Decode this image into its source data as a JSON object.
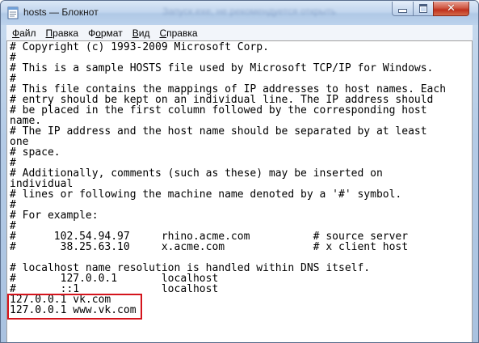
{
  "window": {
    "title": "hosts — Блокнот",
    "background_blur_text": "Запуск.exe, не рекомендуется открыть",
    "controls": {
      "minimize": "minimize",
      "maximize": "maximize",
      "close": "✕"
    }
  },
  "menu": [
    {
      "label": "Файл",
      "accel": "Ф",
      "rest": "айл"
    },
    {
      "label": "Правка",
      "accel": "П",
      "rest": "равка"
    },
    {
      "label": "Формат",
      "accel": "о",
      "pre": "Ф",
      "rest": "рмат"
    },
    {
      "label": "Вид",
      "accel": "В",
      "rest": "ид"
    },
    {
      "label": "Справка",
      "accel": "С",
      "rest": "правка"
    }
  ],
  "document": {
    "lines": [
      "# Copyright (c) 1993-2009 Microsoft Corp.",
      "#",
      "# This is a sample HOSTS file used by Microsoft TCP/IP for Windows.",
      "#",
      "# This file contains the mappings of IP addresses to host names. Each",
      "# entry should be kept on an individual line. The IP address should",
      "# be placed in the first column followed by the corresponding host",
      "name.",
      "# The IP address and the host name should be separated by at least",
      "one",
      "# space.",
      "#",
      "# Additionally, comments (such as these) may be inserted on",
      "individual",
      "# lines or following the machine name denoted by a '#' symbol.",
      "#",
      "# For example:",
      "#",
      "#      102.54.94.97     rhino.acme.com          # source server",
      "#       38.25.63.10     x.acme.com              # x client host",
      "",
      "# localhost name resolution is handled within DNS itself.",
      "#       127.0.0.1       localhost",
      "#       ::1             localhost",
      "127.0.0.1 vk.com",
      "127.0.0.1 www.vk.com"
    ]
  },
  "annotation": {
    "highlight_color": "#d4141c"
  }
}
